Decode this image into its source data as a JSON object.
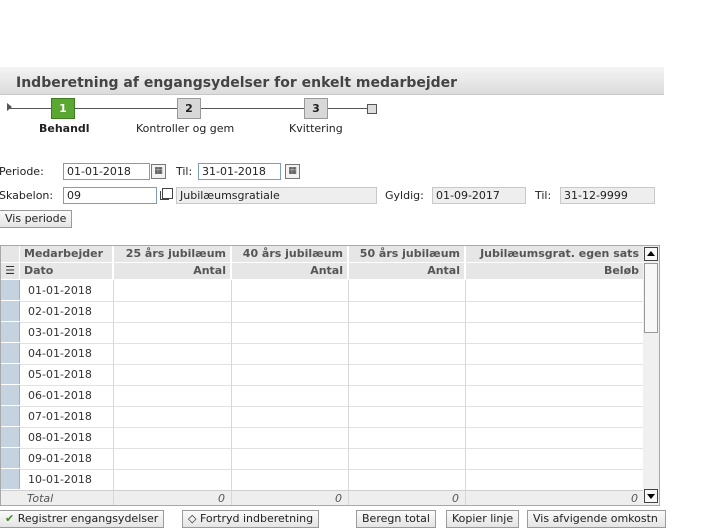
{
  "header": {
    "title": "Indberetning af engangsydelser for enkelt medarbejder"
  },
  "stepper": {
    "steps": [
      {
        "number": "1",
        "label": "Behandl",
        "active": true
      },
      {
        "number": "2",
        "label": "Kontroller og gem",
        "active": false
      },
      {
        "number": "3",
        "label": "Kvittering",
        "active": false
      }
    ]
  },
  "form": {
    "periode_label": "Periode:",
    "periode_from": "01-01-2018",
    "til_label": "Til:",
    "periode_to": "31-01-2018",
    "skabelon_label": "Skabelon:",
    "skabelon_value": "09",
    "skabelon_name": "Jubilæumsgratiale",
    "gyldig_label": "Gyldig:",
    "gyldig_from": "01-09-2017",
    "gyldig_til_label": "Til:",
    "gyldig_to": "31-12-9999",
    "vis_periode_label": "Vis periode"
  },
  "grid": {
    "header1": [
      "Medarbejder",
      "25 års jubilæum",
      "40 års jubilæum",
      "50 års jubilæum",
      "Jubilæumsgrat. egen sats"
    ],
    "header2": [
      "Dato",
      "Antal",
      "Antal",
      "Antal",
      "Beløb"
    ],
    "rows": [
      "01-01-2018",
      "02-01-2018",
      "03-01-2018",
      "04-01-2018",
      "05-01-2018",
      "06-01-2018",
      "07-01-2018",
      "08-01-2018",
      "09-01-2018",
      "10-01-2018"
    ],
    "total_label": "Total",
    "totals": [
      "0",
      "0",
      "0",
      "0"
    ]
  },
  "buttons": {
    "registrer": "Registrer engangsydelser",
    "fortryd": "Fortryd indberetning",
    "beregn": "Beregn total",
    "kopier": "Kopier linje",
    "vis_afvigende": "Vis afvigende omkostn"
  },
  "colors": {
    "active_step": "#5aa832",
    "row_selector": "#c5d3e0",
    "header_bg": "#e6e6e6"
  }
}
